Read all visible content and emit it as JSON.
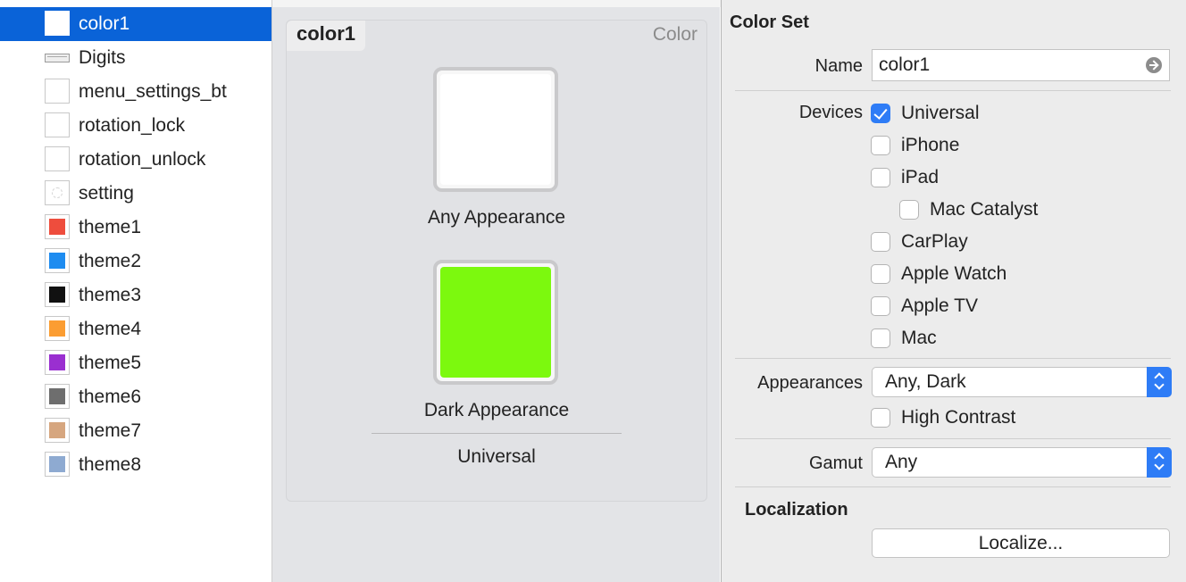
{
  "sidebar": {
    "items": [
      {
        "label": "color1",
        "selected": true,
        "thumb": "white-swatch",
        "color": "#ffffff"
      },
      {
        "label": "Digits",
        "thumb": "digits-icon"
      },
      {
        "label": "menu_settings_bt",
        "thumb": "white-swatch",
        "color": "#ffffff"
      },
      {
        "label": "rotation_lock",
        "thumb": "white-swatch",
        "color": "#ffffff"
      },
      {
        "label": "rotation_unlock",
        "thumb": "white-swatch",
        "color": "#ffffff"
      },
      {
        "label": "setting",
        "thumb": "setting-icon"
      },
      {
        "label": "theme1",
        "thumb": "color-swatch",
        "color": "#ee4d3d"
      },
      {
        "label": "theme2",
        "thumb": "color-swatch",
        "color": "#1e8cf0"
      },
      {
        "label": "theme3",
        "thumb": "color-swatch",
        "color": "#111111"
      },
      {
        "label": "theme4",
        "thumb": "color-swatch",
        "color": "#fb9d32"
      },
      {
        "label": "theme5",
        "thumb": "color-swatch",
        "color": "#9a2fd0"
      },
      {
        "label": "theme6",
        "thumb": "color-swatch",
        "color": "#6e6e6e"
      },
      {
        "label": "theme7",
        "thumb": "color-swatch",
        "color": "#d6a67f"
      },
      {
        "label": "theme8",
        "thumb": "color-swatch",
        "color": "#8eaad1"
      }
    ]
  },
  "editor": {
    "asset_name": "color1",
    "asset_type": "Color",
    "wells": [
      {
        "label": "Any Appearance",
        "color": "#ffffff"
      },
      {
        "label": "Dark Appearance",
        "color": "#7cf90e"
      }
    ],
    "device_label": "Universal"
  },
  "inspector": {
    "title": "Color Set",
    "name_label": "Name",
    "name_value": "color1",
    "devices_label": "Devices",
    "devices": [
      {
        "label": "Universal",
        "checked": true
      },
      {
        "label": "iPhone",
        "checked": false
      },
      {
        "label": "iPad",
        "checked": false
      },
      {
        "label": "Mac Catalyst",
        "checked": false
      },
      {
        "label": "CarPlay",
        "checked": false
      },
      {
        "label": "Apple Watch",
        "checked": false
      },
      {
        "label": "Apple TV",
        "checked": false
      },
      {
        "label": "Mac",
        "checked": false
      }
    ],
    "appearances_label": "Appearances",
    "appearances_value": "Any, Dark",
    "high_contrast_label": "High Contrast",
    "high_contrast_checked": false,
    "gamut_label": "Gamut",
    "gamut_value": "Any",
    "localization_title": "Localization",
    "localize_button": "Localize..."
  },
  "colors": {
    "selection": "#0a63d8",
    "checkbox_accent": "#2e7cf6"
  }
}
